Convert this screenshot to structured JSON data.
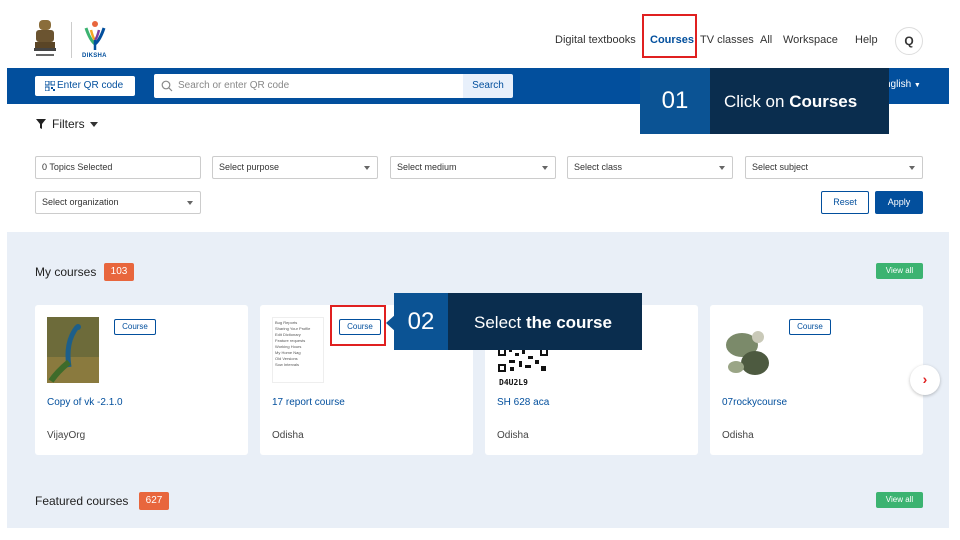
{
  "header": {
    "brand": "DIKSHA",
    "nav": [
      "Digital textbooks",
      "Courses",
      "TV classes",
      "All",
      "Workspace",
      "Help"
    ],
    "profile_initial": "Q"
  },
  "toolbar": {
    "qr_label": "Enter QR code",
    "search_placeholder": "Search or enter QR code",
    "search_button": "Search",
    "language": "nglish"
  },
  "callouts": [
    {
      "number": "01",
      "text_prefix": "Click on ",
      "text_bold": "Courses"
    },
    {
      "number": "02",
      "text_prefix": "Select ",
      "text_bold": "the course"
    }
  ],
  "filters": {
    "title": "Filters",
    "selects": [
      "0 Topics Selected",
      "Select purpose",
      "Select medium",
      "Select class",
      "Select subject",
      "Select organization"
    ],
    "reset": "Reset",
    "apply": "Apply"
  },
  "my_courses": {
    "title": "My courses",
    "count": "103",
    "view_all": "View all",
    "cards": [
      {
        "tag": "Course",
        "title": "Copy of vk -2.1.0",
        "org": "VijayOrg"
      },
      {
        "tag": "Course",
        "title": "17 report course",
        "org": "Odisha"
      },
      {
        "tag": "",
        "title": "SH 628 aca",
        "org": "Odisha",
        "qr_code": "D4U2L9"
      },
      {
        "tag": "Course",
        "title": "07rockycourse",
        "org": "Odisha"
      }
    ]
  },
  "featured_courses": {
    "title": "Featured courses",
    "count": "627",
    "view_all": "View all"
  },
  "thumb_list": [
    "Bug Reports",
    "Sharing Your Profile",
    "Edit Dictionary",
    "Feature requests",
    "Working Hours",
    "My Home Nag",
    "Old Versions",
    "Sow Intervals"
  ],
  "colors": {
    "brand": "#024f9d",
    "badge": "#e8663d",
    "view_all": "#3cb371",
    "highlight": "#e02020",
    "callout": "#0a2d4e"
  }
}
